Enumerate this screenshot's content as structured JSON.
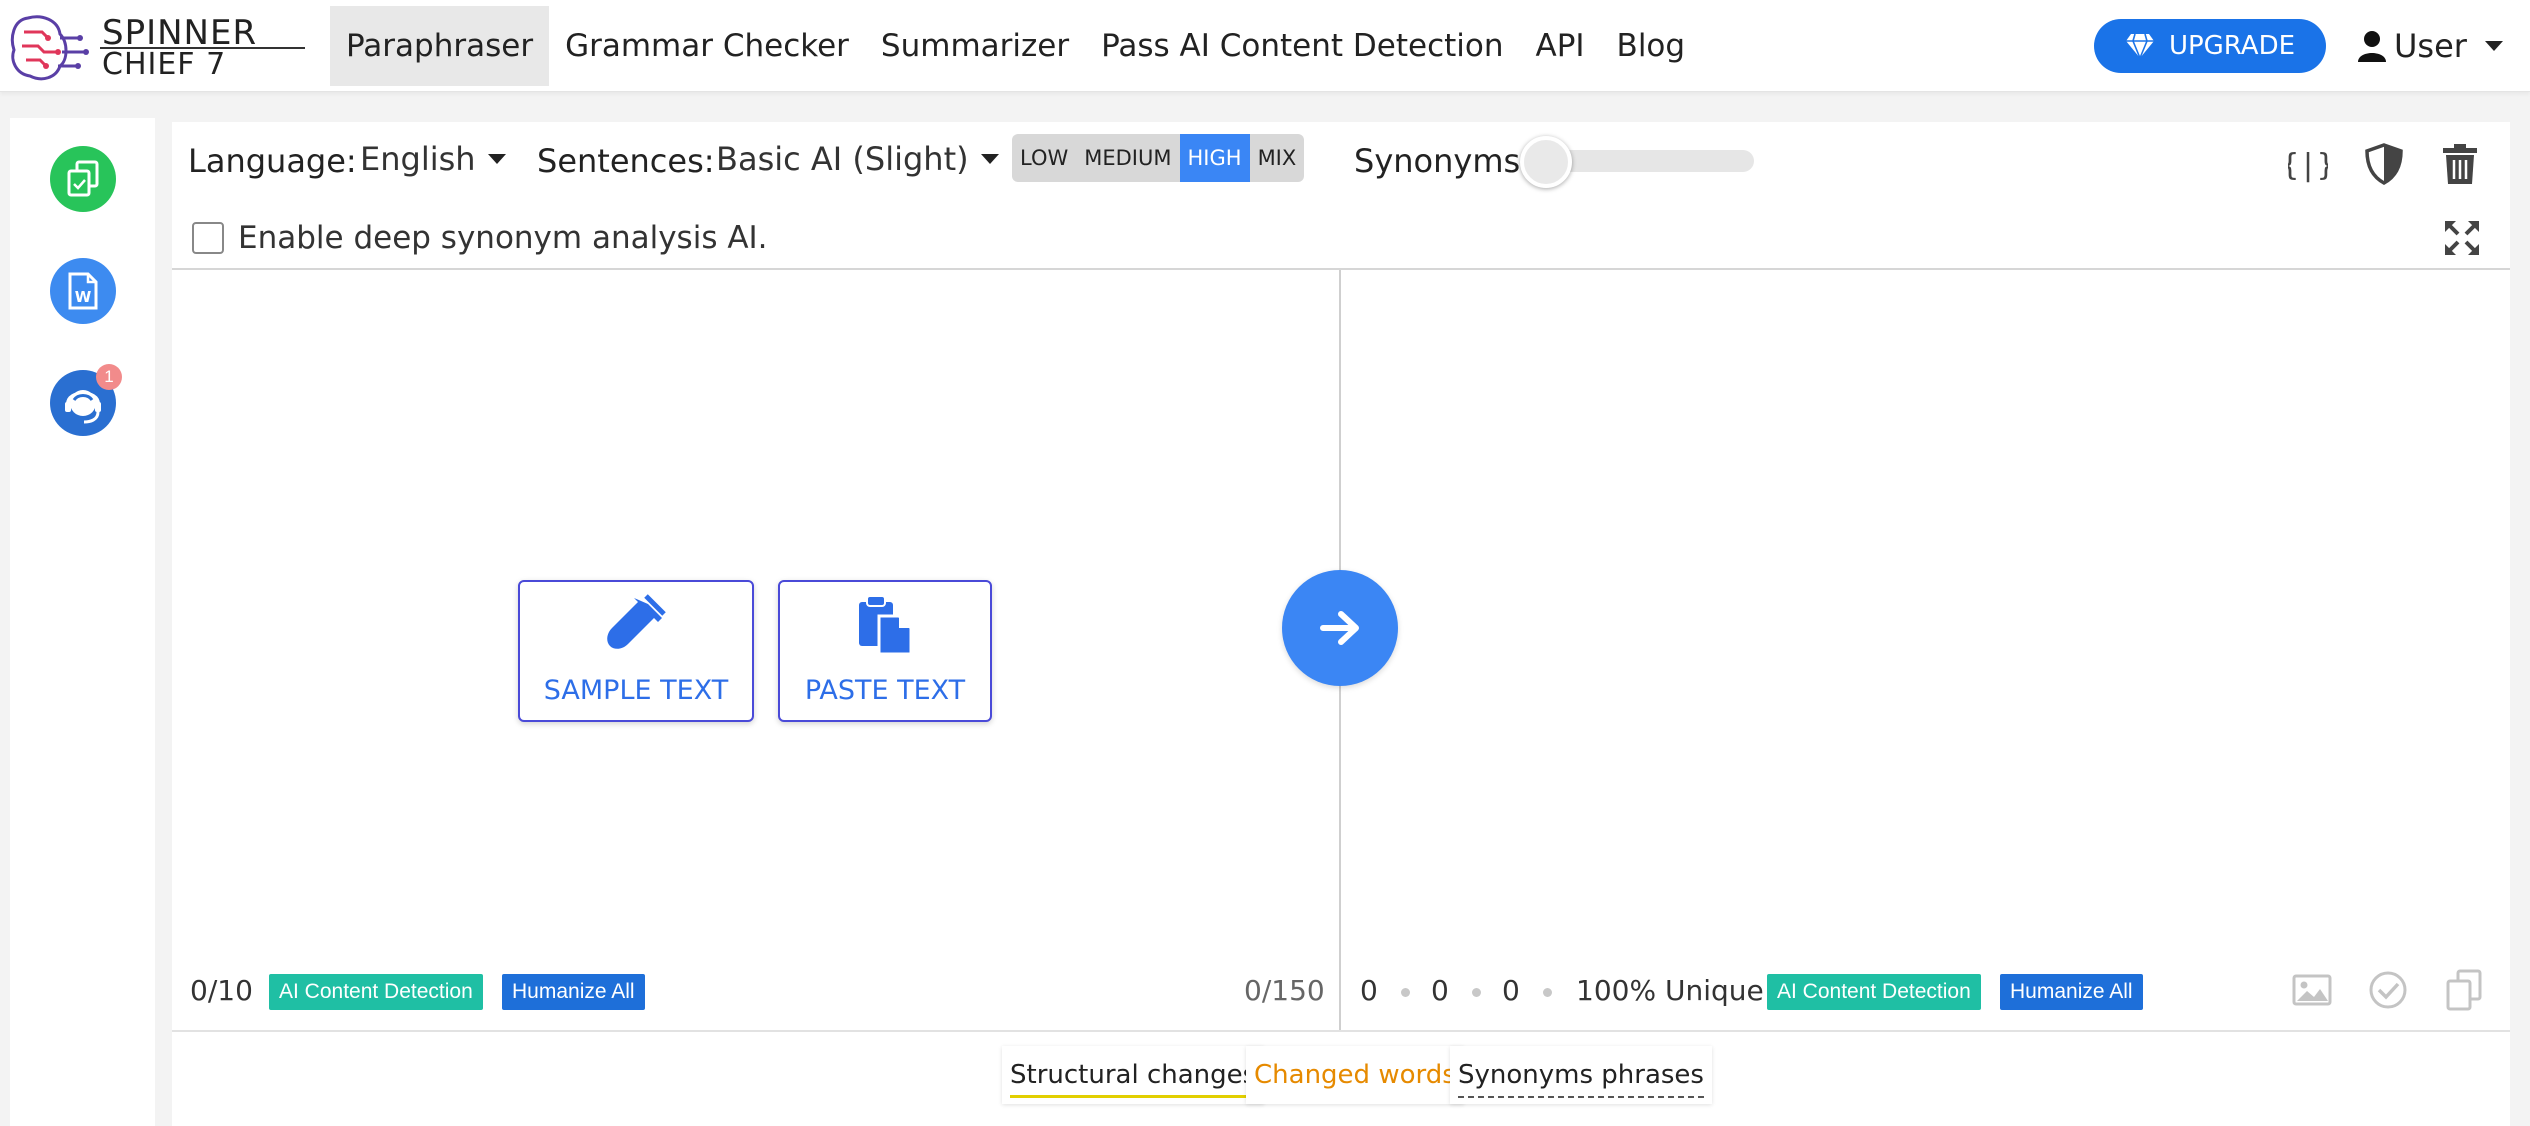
{
  "brand": {
    "line1": "SPINNER",
    "line2": "CHIEF 7"
  },
  "nav": {
    "items": [
      "Paraphraser",
      "Grammar Checker",
      "Summarizer",
      "Pass AI Content Detection",
      "API",
      "Blog"
    ],
    "active": "Paraphraser",
    "upgrade_label": "UPGRADE",
    "user_label": "User"
  },
  "sidebar": {
    "items": [
      {
        "icon": "copy-document-icon"
      },
      {
        "icon": "word-document-icon"
      },
      {
        "icon": "support-agent-icon",
        "badge": "1"
      }
    ]
  },
  "toolbar": {
    "language_label": "Language:",
    "language_value": "English",
    "sentences_label": "Sentences:",
    "sentences_value": "Basic AI (Slight)",
    "levels": [
      "LOW",
      "MEDIUM",
      "HIGH",
      "MIX"
    ],
    "selected_level": "HIGH",
    "synonyms_label": "Synonyms:",
    "synonyms_level": 0,
    "deep_synonym_label": "Enable deep synonym analysis AI.",
    "deep_synonym_checked": false,
    "icons": [
      "code-braces-icon",
      "shield-icon",
      "trash-icon",
      "expand-icon"
    ]
  },
  "input_panel": {
    "sample_text_label": "SAMPLE TEXT",
    "paste_text_label": "PASTE TEXT",
    "count": "0/10",
    "char_count": "0/150",
    "ai_detection_label": "AI Content Detection",
    "humanize_label": "Humanize All"
  },
  "output_panel": {
    "stat1": "0",
    "stat2": "0",
    "stat3": "0",
    "unique": "100% Unique",
    "ai_detection_label": "AI Content Detection",
    "humanize_label": "Humanize All",
    "icons": [
      "image-icon",
      "check-circle-icon",
      "copy-icon"
    ]
  },
  "legend": {
    "structural": "Structural changes",
    "changed": "Changed words",
    "synonyms": "Synonyms phrases"
  },
  "colors": {
    "primary": "#1a73e8",
    "teal": "#1fbfa4",
    "orange": "#e68a00",
    "green": "#28c45a"
  }
}
